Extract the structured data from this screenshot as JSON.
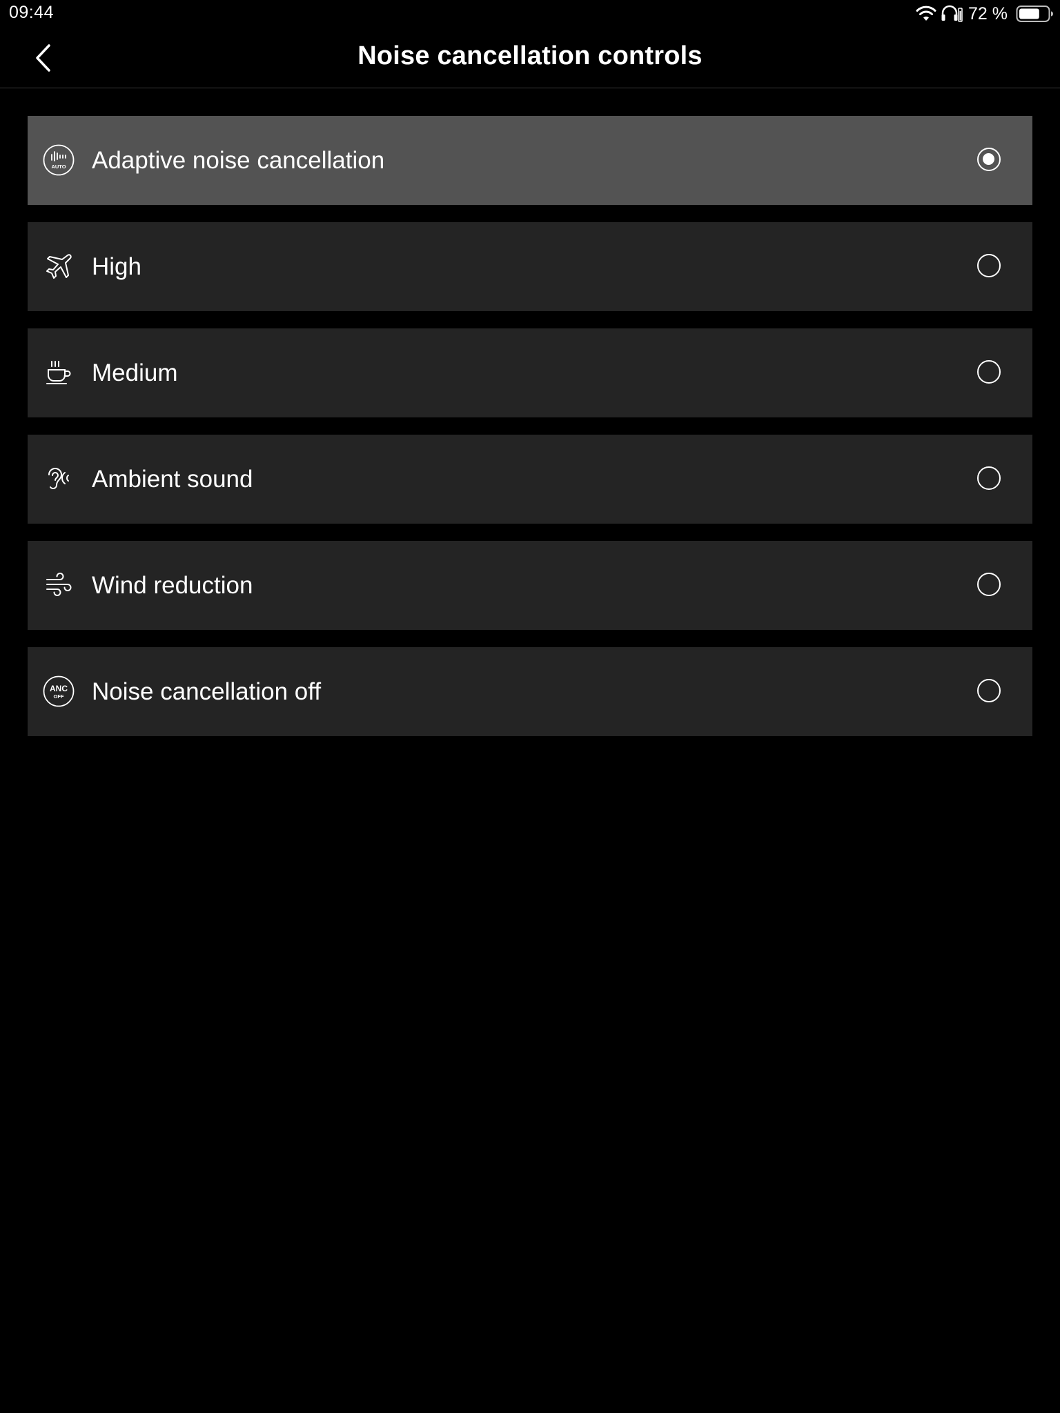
{
  "status_bar": {
    "time": "09:44",
    "battery_percent_text": "72 %",
    "battery_level": 0.72,
    "icons": [
      "wifi-icon",
      "headphones-battery-icon",
      "battery-icon"
    ]
  },
  "header": {
    "title": "Noise cancellation controls",
    "back_icon": "chevron-left-icon"
  },
  "options": [
    {
      "label": "Adaptive noise cancellation",
      "icon": "auto-anc-icon",
      "selected": true
    },
    {
      "label": "High",
      "icon": "airplane-icon",
      "selected": false
    },
    {
      "label": "Medium",
      "icon": "coffee-cup-icon",
      "selected": false
    },
    {
      "label": "Ambient sound",
      "icon": "ear-icon",
      "selected": false
    },
    {
      "label": "Wind reduction",
      "icon": "wind-icon",
      "selected": false
    },
    {
      "label": "Noise cancellation off",
      "icon": "anc-off-icon",
      "selected": false
    }
  ],
  "icon_texts": {
    "auto": "AUTO",
    "anc": "ANC",
    "off": "OFF"
  },
  "colors": {
    "background": "#000000",
    "row": "#242424",
    "row_selected": "#535353",
    "text": "#ffffff"
  }
}
